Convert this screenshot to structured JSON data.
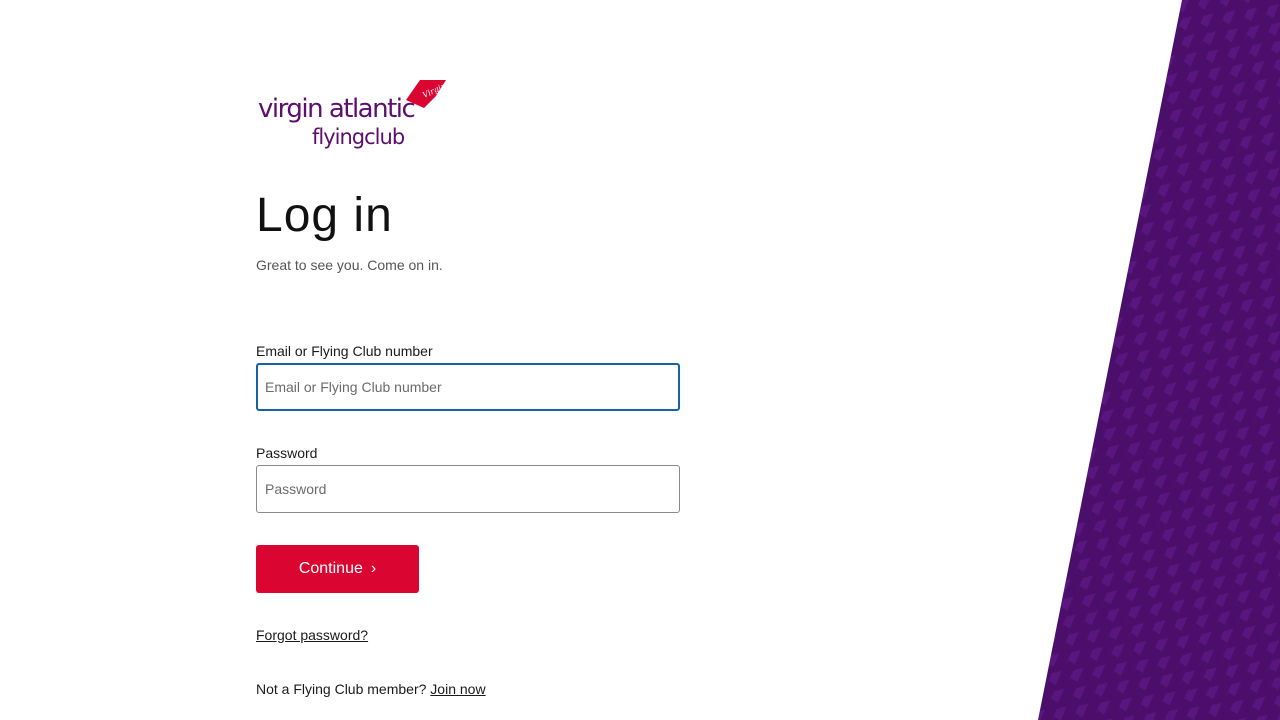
{
  "brand": {
    "logo_text_line1": "virgin atlantic",
    "logo_text_line2": "flyingclub",
    "logo_tail_text": "Virgin",
    "primary_color": "#5c0f6e",
    "accent_color": "#da0530"
  },
  "page": {
    "title": "Log in",
    "subtitle": "Great to see you. Come on in."
  },
  "form": {
    "email": {
      "label": "Email or Flying Club number",
      "placeholder": "Email or Flying Club number",
      "value": ""
    },
    "password": {
      "label": "Password",
      "placeholder": "Password",
      "value": ""
    },
    "continue_label": "Continue",
    "continue_icon": "chevron-right-icon"
  },
  "links": {
    "forgot_password": "Forgot password?",
    "join_prompt": "Not a Flying Club member?",
    "join_now": "Join now"
  },
  "decor": {
    "panel_color": "#4b0f6b",
    "pattern_color": "#6a1f8c"
  }
}
